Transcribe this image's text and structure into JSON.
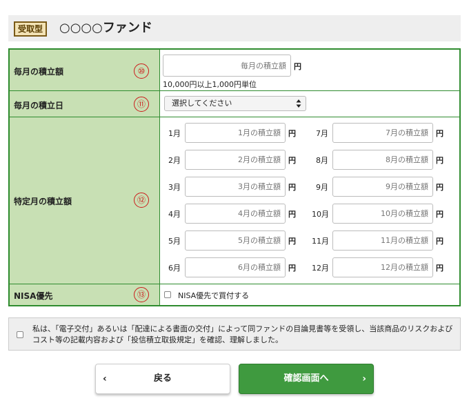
{
  "header": {
    "badge": "受取型",
    "fund_name": "○○○○ファンド"
  },
  "monthly": {
    "label": "毎月の積立額",
    "number": "⑩",
    "placeholder": "毎月の積立額",
    "unit": "円",
    "hint": "10,000円以上1,000円単位"
  },
  "date": {
    "label": "毎月の積立日",
    "number": "⑪",
    "selected": "選択してください"
  },
  "specific": {
    "label": "特定月の積立額",
    "number": "⑫",
    "unit": "円",
    "months": [
      {
        "label": "1月",
        "placeholder": "1月の積立額"
      },
      {
        "label": "2月",
        "placeholder": "2月の積立額"
      },
      {
        "label": "3月",
        "placeholder": "3月の積立額"
      },
      {
        "label": "4月",
        "placeholder": "4月の積立額"
      },
      {
        "label": "5月",
        "placeholder": "5月の積立額"
      },
      {
        "label": "6月",
        "placeholder": "6月の積立額"
      },
      {
        "label": "7月",
        "placeholder": "7月の積立額"
      },
      {
        "label": "8月",
        "placeholder": "8月の積立額"
      },
      {
        "label": "9月",
        "placeholder": "9月の積立額"
      },
      {
        "label": "10月",
        "placeholder": "10月の積立額"
      },
      {
        "label": "11月",
        "placeholder": "11月の積立額"
      },
      {
        "label": "12月",
        "placeholder": "12月の積立額"
      }
    ]
  },
  "nisa": {
    "label": "NISA優先",
    "number": "⑬",
    "checkbox_label": "NISA優先で買付する"
  },
  "consent": {
    "text": "私は、「電子交付」あるいは「配達による書面の交付」によって同ファンドの目論見書等を受領し、当該商品のリスクおよびコスト等の記載内容および「投信積立取扱規定」を確認、理解しました。"
  },
  "buttons": {
    "back": "戻る",
    "next": "確認画面へ",
    "back_chevron": "‹",
    "next_chevron": "›"
  },
  "colors": {
    "border_green": "#2e8b2e",
    "label_bg": "#c8e0b4",
    "accent_red": "#cc1a1a",
    "next_button": "#3f9a3f"
  }
}
